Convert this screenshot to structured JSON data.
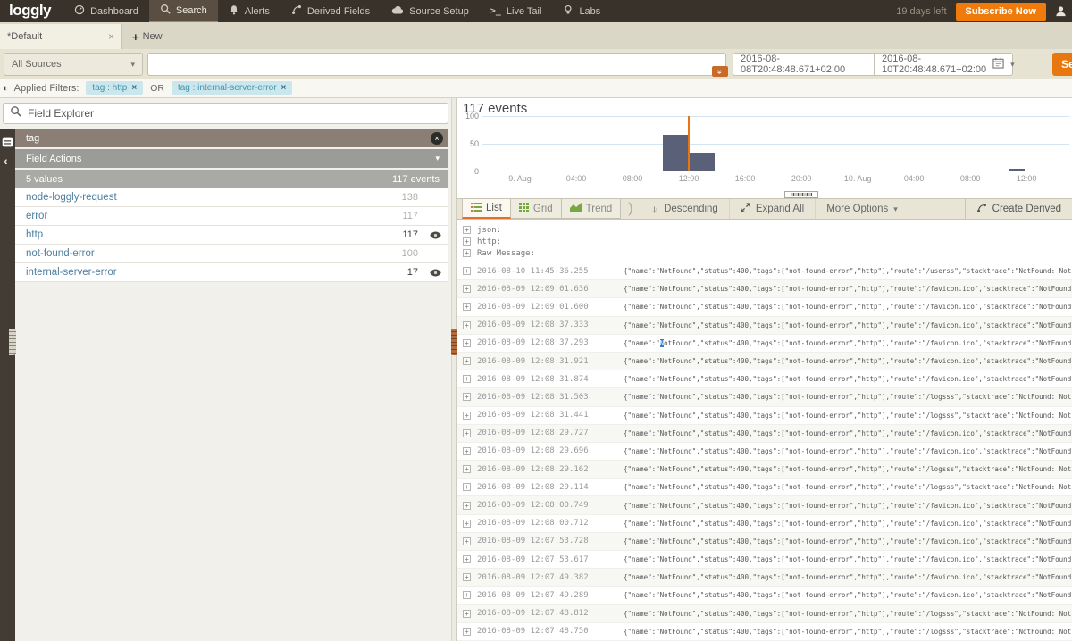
{
  "colors": {
    "accent_orange": "#e8770d",
    "icon_green": "#7aa642",
    "link_blue": "#4e7f9e",
    "chip_bg": "#cbe6ec",
    "chip_text": "#4095ab",
    "bar_color": "#596078",
    "cursor_color": "#e87511"
  },
  "nav": {
    "brand": "loggly",
    "items": [
      {
        "label": "Dashboard"
      },
      {
        "label": "Search",
        "active": true
      },
      {
        "label": "Alerts"
      },
      {
        "label": "Derived Fields"
      },
      {
        "label": "Source Setup"
      },
      {
        "label": "Live Tail"
      },
      {
        "label": "Labs"
      }
    ],
    "trial_text": "19 days left",
    "subscribe_label": "Subscribe Now"
  },
  "tabs": {
    "items": [
      {
        "label": "*Default"
      }
    ],
    "new_label": "New"
  },
  "search_bar": {
    "source_selector": "All Sources",
    "query_value": "",
    "date_from": "2016-08-08T20:48:48.671+02:00",
    "date_to": "2016-08-10T20:48:48.671+02:00",
    "search_label": "Search"
  },
  "applied_filters": {
    "label": "Applied Filters:",
    "operator": "OR",
    "chips": [
      {
        "text": "tag : http"
      },
      {
        "text": "tag : internal-server-error"
      }
    ]
  },
  "field_explorer": {
    "placeholder": "Field Explorer",
    "field_name": "tag",
    "actions_label": "Field Actions",
    "values_count_label": "5 values",
    "events_count_label": "117 events",
    "values": [
      {
        "name": "node-loggly-request",
        "count": "138",
        "active": false
      },
      {
        "name": "error",
        "count": "117",
        "active": false
      },
      {
        "name": "http",
        "count": "117",
        "active": true
      },
      {
        "name": "not-found-error",
        "count": "100",
        "active": false
      },
      {
        "name": "internal-server-error",
        "count": "17",
        "active": true
      }
    ]
  },
  "chart_data": {
    "type": "bar",
    "title": "117 events",
    "xlabel": "",
    "ylabel": "",
    "ylim": [
      0,
      100
    ],
    "yticks": [
      0,
      50,
      100
    ],
    "xticks": [
      "9. Aug",
      "04:00",
      "08:00",
      "12:00",
      "16:00",
      "20:00",
      "10. Aug",
      "04:00",
      "08:00",
      "12:00"
    ],
    "bars": [
      {
        "time": "2016-08-09 ~10:30",
        "value": 65,
        "x_frac": 0.307,
        "w_frac": 0.043
      },
      {
        "time": "2016-08-09 ~12:30",
        "value": 33,
        "x_frac": 0.352,
        "w_frac": 0.043
      },
      {
        "time": "2016-08-10 ~10:30",
        "value": 3,
        "x_frac": 0.898,
        "w_frac": 0.026
      }
    ],
    "cursor_line_frac": 0.3505,
    "bar_color": "#596078",
    "cursor_color": "#e87511",
    "layout": {
      "grid": true,
      "first_tick_frac": 0.064,
      "tick_step_frac": 0.0959
    }
  },
  "toolbar": {
    "list_label": "List",
    "grid_label": "Grid",
    "trend_label": "Trend",
    "descending_label": "Descending",
    "expand_all_label": "Expand All",
    "more_options_label": "More Options",
    "create_derived_label": "Create Derived"
  },
  "log_list": {
    "expanders": [
      "json:",
      "http:",
      "Raw Message:"
    ],
    "rows": [
      {
        "timestamp": "2016-08-10 11:45:36.255",
        "message": "{\"name\":\"NotFound\",\"status\":400,\"tags\":[\"not-found-error\",\"http\"],\"route\":\"/userss\",\"stacktrace\":\"NotFound: Not Found"
      },
      {
        "timestamp": "2016-08-09 12:09:01.636",
        "message": "{\"name\":\"NotFound\",\"status\":400,\"tags\":[\"not-found-error\",\"http\"],\"route\":\"/favicon.ico\",\"stacktrace\":\"NotFound: Not Found"
      },
      {
        "timestamp": "2016-08-09 12:09:01.600",
        "message": "{\"name\":\"NotFound\",\"status\":400,\"tags\":[\"not-found-error\",\"http\"],\"route\":\"/favicon.ico\",\"stacktrace\":\"NotFound: Not Found"
      },
      {
        "timestamp": "2016-08-09 12:08:37.333",
        "message": "{\"name\":\"NotFound\",\"status\":400,\"tags\":[\"not-found-error\",\"http\"],\"route\":\"/favicon.ico\",\"stacktrace\":\"NotFound: Not Found"
      },
      {
        "timestamp": "2016-08-09 12:08:37.293",
        "selected_char": "N",
        "message": "{\"name\":\"NotFound\",\"status\":400,\"tags\":[\"not-found-error\",\"http\"],\"route\":\"/favicon.ico\",\"stacktrace\":\"NotFound: Not Found"
      },
      {
        "timestamp": "2016-08-09 12:08:31.921",
        "message": "{\"name\":\"NotFound\",\"status\":400,\"tags\":[\"not-found-error\",\"http\"],\"route\":\"/favicon.ico\",\"stacktrace\":\"NotFound: Not Found"
      },
      {
        "timestamp": "2016-08-09 12:08:31.874",
        "message": "{\"name\":\"NotFound\",\"status\":400,\"tags\":[\"not-found-error\",\"http\"],\"route\":\"/favicon.ico\",\"stacktrace\":\"NotFound: Not Found"
      },
      {
        "timestamp": "2016-08-09 12:08:31.503",
        "message": "{\"name\":\"NotFound\",\"status\":400,\"tags\":[\"not-found-error\",\"http\"],\"route\":\"/logsss\",\"stacktrace\":\"NotFound: Not Found"
      },
      {
        "timestamp": "2016-08-09 12:08:31.441",
        "message": "{\"name\":\"NotFound\",\"status\":400,\"tags\":[\"not-found-error\",\"http\"],\"route\":\"/logsss\",\"stacktrace\":\"NotFound: Not Found"
      },
      {
        "timestamp": "2016-08-09 12:08:29.727",
        "message": "{\"name\":\"NotFound\",\"status\":400,\"tags\":[\"not-found-error\",\"http\"],\"route\":\"/favicon.ico\",\"stacktrace\":\"NotFound: Not Found"
      },
      {
        "timestamp": "2016-08-09 12:08:29.696",
        "message": "{\"name\":\"NotFound\",\"status\":400,\"tags\":[\"not-found-error\",\"http\"],\"route\":\"/favicon.ico\",\"stacktrace\":\"NotFound: Not Found"
      },
      {
        "timestamp": "2016-08-09 12:08:29.162",
        "message": "{\"name\":\"NotFound\",\"status\":400,\"tags\":[\"not-found-error\",\"http\"],\"route\":\"/logsss\",\"stacktrace\":\"NotFound: Not Found"
      },
      {
        "timestamp": "2016-08-09 12:08:29.114",
        "message": "{\"name\":\"NotFound\",\"status\":400,\"tags\":[\"not-found-error\",\"http\"],\"route\":\"/logsss\",\"stacktrace\":\"NotFound: Not Found"
      },
      {
        "timestamp": "2016-08-09 12:08:00.749",
        "message": "{\"name\":\"NotFound\",\"status\":400,\"tags\":[\"not-found-error\",\"http\"],\"route\":\"/favicon.ico\",\"stacktrace\":\"NotFound: Not Found"
      },
      {
        "timestamp": "2016-08-09 12:08:00.712",
        "message": "{\"name\":\"NotFound\",\"status\":400,\"tags\":[\"not-found-error\",\"http\"],\"route\":\"/favicon.ico\",\"stacktrace\":\"NotFound: Not Found"
      },
      {
        "timestamp": "2016-08-09 12:07:53.728",
        "message": "{\"name\":\"NotFound\",\"status\":400,\"tags\":[\"not-found-error\",\"http\"],\"route\":\"/favicon.ico\",\"stacktrace\":\"NotFound: Not Found"
      },
      {
        "timestamp": "2016-08-09 12:07:53.617",
        "message": "{\"name\":\"NotFound\",\"status\":400,\"tags\":[\"not-found-error\",\"http\"],\"route\":\"/favicon.ico\",\"stacktrace\":\"NotFound: Not Found"
      },
      {
        "timestamp": "2016-08-09 12:07:49.382",
        "message": "{\"name\":\"NotFound\",\"status\":400,\"tags\":[\"not-found-error\",\"http\"],\"route\":\"/favicon.ico\",\"stacktrace\":\"NotFound: Not Found"
      },
      {
        "timestamp": "2016-08-09 12:07:49.289",
        "message": "{\"name\":\"NotFound\",\"status\":400,\"tags\":[\"not-found-error\",\"http\"],\"route\":\"/favicon.ico\",\"stacktrace\":\"NotFound: Not Found"
      },
      {
        "timestamp": "2016-08-09 12:07:48.812",
        "message": "{\"name\":\"NotFound\",\"status\":400,\"tags\":[\"not-found-error\",\"http\"],\"route\":\"/logsss\",\"stacktrace\":\"NotFound: Not Found"
      },
      {
        "timestamp": "2016-08-09 12:07:48.750",
        "message": "{\"name\":\"NotFound\",\"status\":400,\"tags\":[\"not-found-error\",\"http\"],\"route\":\"/logsss\",\"stacktrace\":\"NotFound: Not Found"
      }
    ]
  }
}
